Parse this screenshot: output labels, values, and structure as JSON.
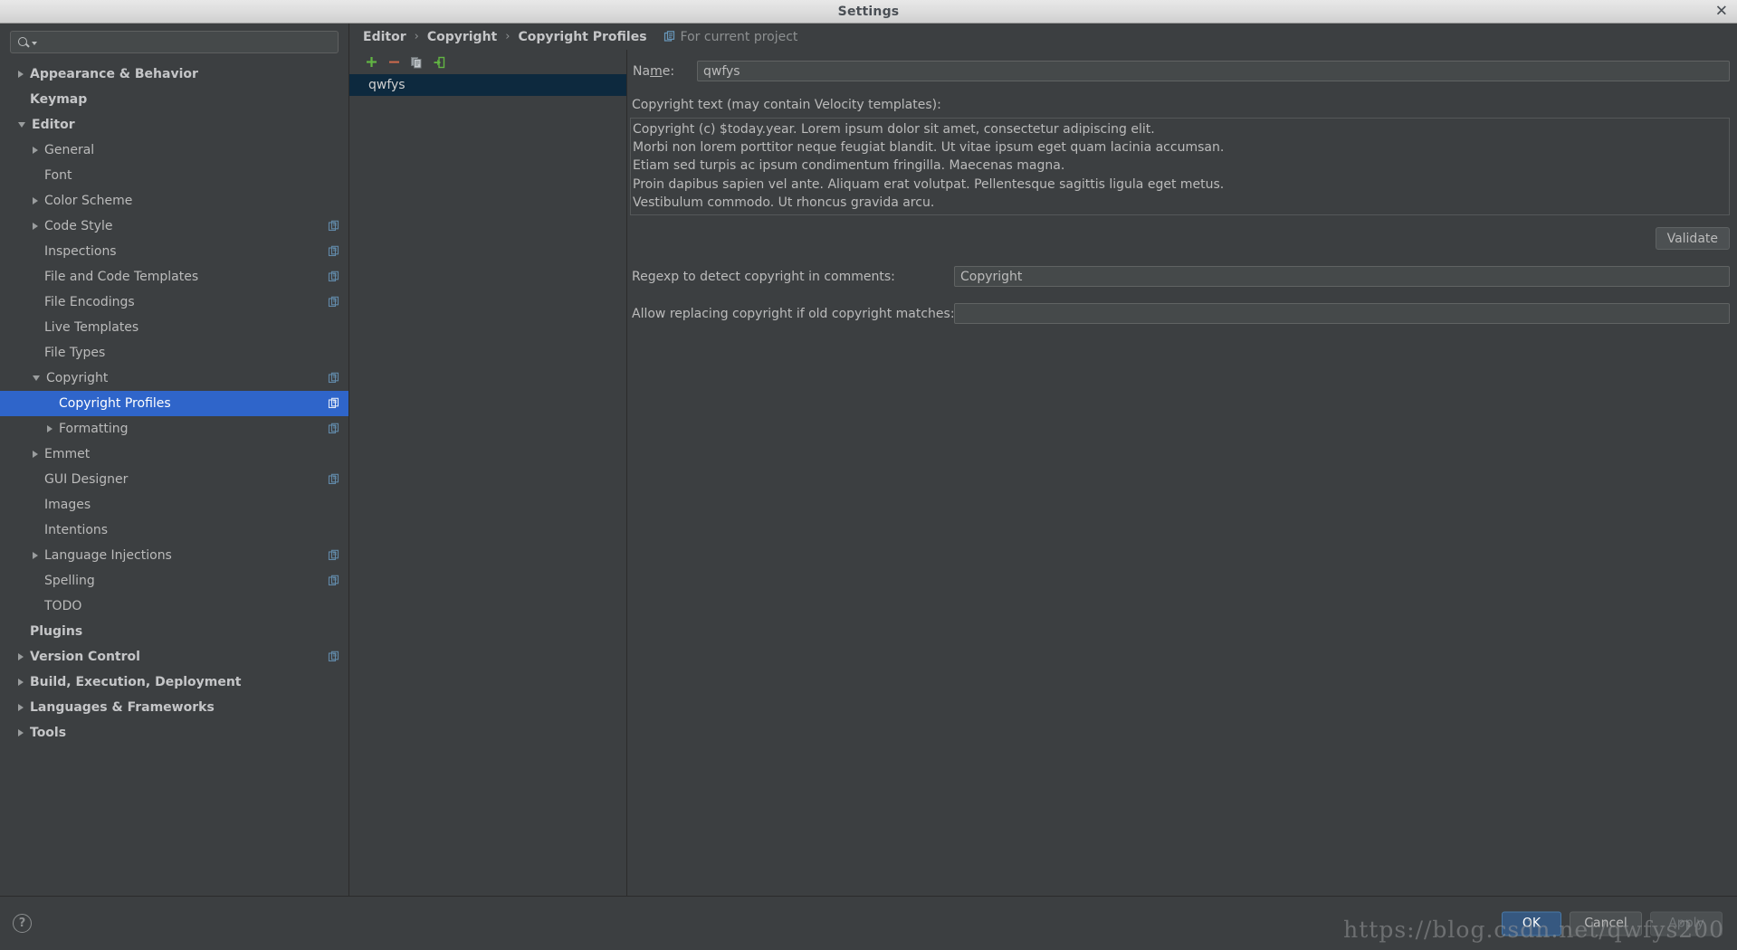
{
  "window": {
    "title": "Settings",
    "close_label": "✕"
  },
  "sidebar": {
    "search": {
      "value": "",
      "placeholder": ""
    },
    "items": [
      {
        "label": "Appearance & Behavior",
        "indent": 0,
        "arrow": "closed",
        "bold": true,
        "selected": false,
        "badge": false
      },
      {
        "label": "Keymap",
        "indent": 0,
        "arrow": "none",
        "bold": true,
        "selected": false,
        "badge": false
      },
      {
        "label": "Editor",
        "indent": 0,
        "arrow": "open",
        "bold": true,
        "selected": false,
        "badge": false
      },
      {
        "label": "General",
        "indent": 1,
        "arrow": "closed",
        "bold": false,
        "selected": false,
        "badge": false
      },
      {
        "label": "Font",
        "indent": 1,
        "arrow": "none",
        "bold": false,
        "selected": false,
        "badge": false
      },
      {
        "label": "Color Scheme",
        "indent": 1,
        "arrow": "closed",
        "bold": false,
        "selected": false,
        "badge": false
      },
      {
        "label": "Code Style",
        "indent": 1,
        "arrow": "closed",
        "bold": false,
        "selected": false,
        "badge": true
      },
      {
        "label": "Inspections",
        "indent": 1,
        "arrow": "none",
        "bold": false,
        "selected": false,
        "badge": true
      },
      {
        "label": "File and Code Templates",
        "indent": 1,
        "arrow": "none",
        "bold": false,
        "selected": false,
        "badge": true
      },
      {
        "label": "File Encodings",
        "indent": 1,
        "arrow": "none",
        "bold": false,
        "selected": false,
        "badge": true
      },
      {
        "label": "Live Templates",
        "indent": 1,
        "arrow": "none",
        "bold": false,
        "selected": false,
        "badge": false
      },
      {
        "label": "File Types",
        "indent": 1,
        "arrow": "none",
        "bold": false,
        "selected": false,
        "badge": false
      },
      {
        "label": "Copyright",
        "indent": 1,
        "arrow": "open",
        "bold": false,
        "selected": false,
        "badge": true
      },
      {
        "label": "Copyright Profiles",
        "indent": 2,
        "arrow": "none",
        "bold": false,
        "selected": true,
        "badge": true
      },
      {
        "label": "Formatting",
        "indent": 2,
        "arrow": "closed",
        "bold": false,
        "selected": false,
        "badge": true
      },
      {
        "label": "Emmet",
        "indent": 1,
        "arrow": "closed",
        "bold": false,
        "selected": false,
        "badge": false
      },
      {
        "label": "GUI Designer",
        "indent": 1,
        "arrow": "none",
        "bold": false,
        "selected": false,
        "badge": true
      },
      {
        "label": "Images",
        "indent": 1,
        "arrow": "none",
        "bold": false,
        "selected": false,
        "badge": false
      },
      {
        "label": "Intentions",
        "indent": 1,
        "arrow": "none",
        "bold": false,
        "selected": false,
        "badge": false
      },
      {
        "label": "Language Injections",
        "indent": 1,
        "arrow": "closed",
        "bold": false,
        "selected": false,
        "badge": true
      },
      {
        "label": "Spelling",
        "indent": 1,
        "arrow": "none",
        "bold": false,
        "selected": false,
        "badge": true
      },
      {
        "label": "TODO",
        "indent": 1,
        "arrow": "none",
        "bold": false,
        "selected": false,
        "badge": false
      },
      {
        "label": "Plugins",
        "indent": 0,
        "arrow": "none",
        "bold": true,
        "selected": false,
        "badge": false
      },
      {
        "label": "Version Control",
        "indent": 0,
        "arrow": "closed",
        "bold": true,
        "selected": false,
        "badge": true
      },
      {
        "label": "Build, Execution, Deployment",
        "indent": 0,
        "arrow": "closed",
        "bold": true,
        "selected": false,
        "badge": false
      },
      {
        "label": "Languages & Frameworks",
        "indent": 0,
        "arrow": "closed",
        "bold": true,
        "selected": false,
        "badge": false
      },
      {
        "label": "Tools",
        "indent": 0,
        "arrow": "closed",
        "bold": true,
        "selected": false,
        "badge": false
      }
    ]
  },
  "breadcrumb": {
    "items": [
      "Editor",
      "Copyright",
      "Copyright Profiles"
    ],
    "separator": "›",
    "scope_note": "For current project"
  },
  "profiles": {
    "toolbar": {
      "add_label": "+",
      "remove_label": "−",
      "copy_label": "copy-icon",
      "import_label": "import-icon"
    },
    "items": [
      {
        "label": "qwfys",
        "selected": true
      }
    ]
  },
  "details": {
    "name_label_pre": "Na",
    "name_label_mnemonic": "m",
    "name_label_post": "e:",
    "name_value": "qwfys",
    "copyright_text_label": "Copyright text (may contain Velocity templates):",
    "copyright_text": "Copyright (c) $today.year. Lorem ipsum dolor sit amet, consectetur adipiscing elit.\nMorbi non lorem porttitor neque feugiat blandit. Ut vitae ipsum eget quam lacinia accumsan.\nEtiam sed turpis ac ipsum condimentum fringilla. Maecenas magna.\nProin dapibus sapien vel ante. Aliquam erat volutpat. Pellentesque sagittis ligula eget metus.\nVestibulum commodo. Ut rhoncus gravida arcu.",
    "validate_label": "Validate",
    "regex_detect_label": "Regexp to detect copyright in comments:",
    "regex_detect_value": "Copyright",
    "regex_replace_label": "Allow replacing copyright if old copyright matches:",
    "regex_replace_value": ""
  },
  "footer": {
    "help_label": "?",
    "ok_label": "OK",
    "cancel_label": "Cancel",
    "apply_label": "Apply",
    "watermark": "https://blog.csdn.net/qwfys200"
  },
  "colors": {
    "accent_selection": "#2f65ca",
    "list_selection": "#0d293e",
    "primary_button": "#365880",
    "background": "#3c3f41"
  }
}
